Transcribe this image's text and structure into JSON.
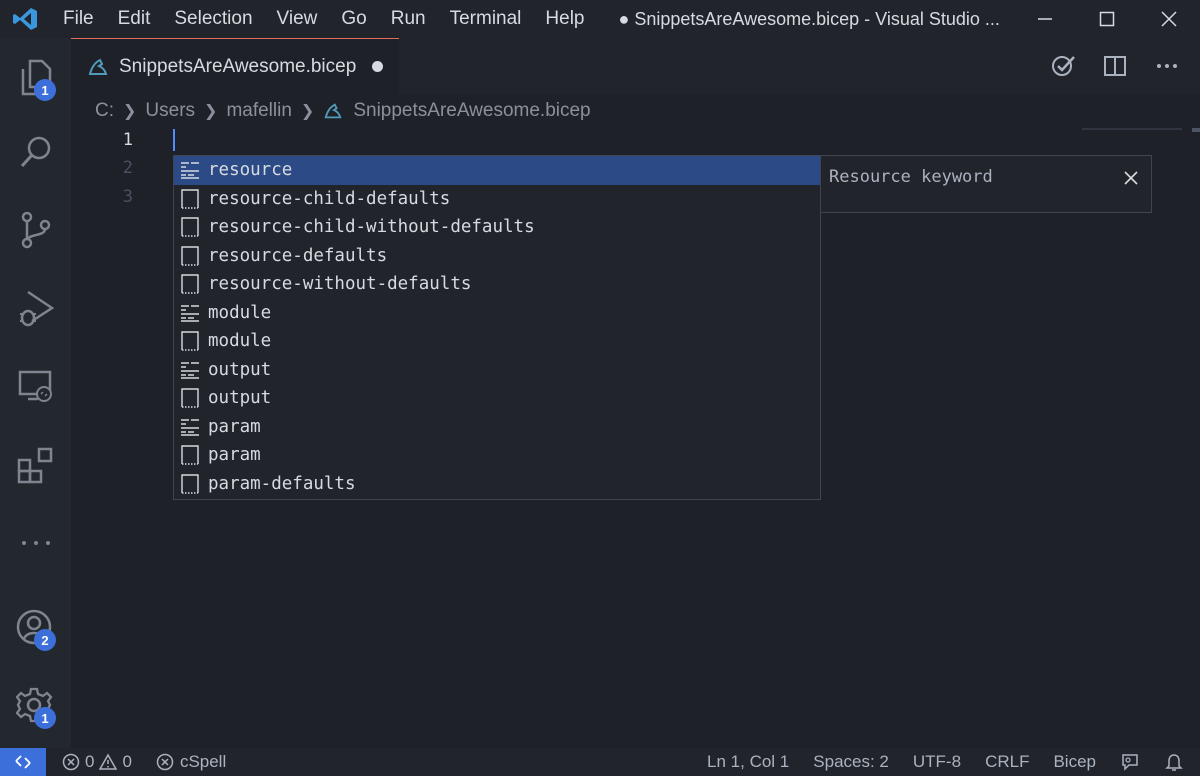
{
  "titlebar": {
    "menu": [
      "File",
      "Edit",
      "Selection",
      "View",
      "Go",
      "Run",
      "Terminal",
      "Help"
    ],
    "window_title": "● SnippetsAreAwesome.bicep - Visual Studio ..."
  },
  "activitybar": {
    "explorer_badge": "1",
    "accounts_badge": "2",
    "manage_badge": "1"
  },
  "tab": {
    "label": "SnippetsAreAwesome.bicep"
  },
  "breadcrumb": {
    "parts": [
      "C:",
      "Users",
      "mafellin",
      "SnippetsAreAwesome.bicep"
    ]
  },
  "editor": {
    "line_numbers": [
      "1",
      "2",
      "3"
    ]
  },
  "suggest": {
    "items": [
      {
        "label": "resource",
        "kind": "keyword"
      },
      {
        "label": "resource-child-defaults",
        "kind": "snippet"
      },
      {
        "label": "resource-child-without-defaults",
        "kind": "snippet"
      },
      {
        "label": "resource-defaults",
        "kind": "snippet"
      },
      {
        "label": "resource-without-defaults",
        "kind": "snippet"
      },
      {
        "label": "module",
        "kind": "keyword"
      },
      {
        "label": "module",
        "kind": "snippet"
      },
      {
        "label": "output",
        "kind": "keyword"
      },
      {
        "label": "output",
        "kind": "snippet"
      },
      {
        "label": "param",
        "kind": "keyword"
      },
      {
        "label": "param",
        "kind": "snippet"
      },
      {
        "label": "param-defaults",
        "kind": "snippet"
      }
    ],
    "details": "Resource keyword"
  },
  "statusbar": {
    "errors": "0",
    "warnings": "0",
    "spell": "cSpell",
    "position": "Ln 1, Col 1",
    "spaces": "Spaces: 2",
    "encoding": "UTF-8",
    "eol": "CRLF",
    "language": "Bicep"
  },
  "colors": {
    "accent": "#3c6fd9",
    "selection": "#2c4a86",
    "tab_border": "#e06c5a"
  }
}
